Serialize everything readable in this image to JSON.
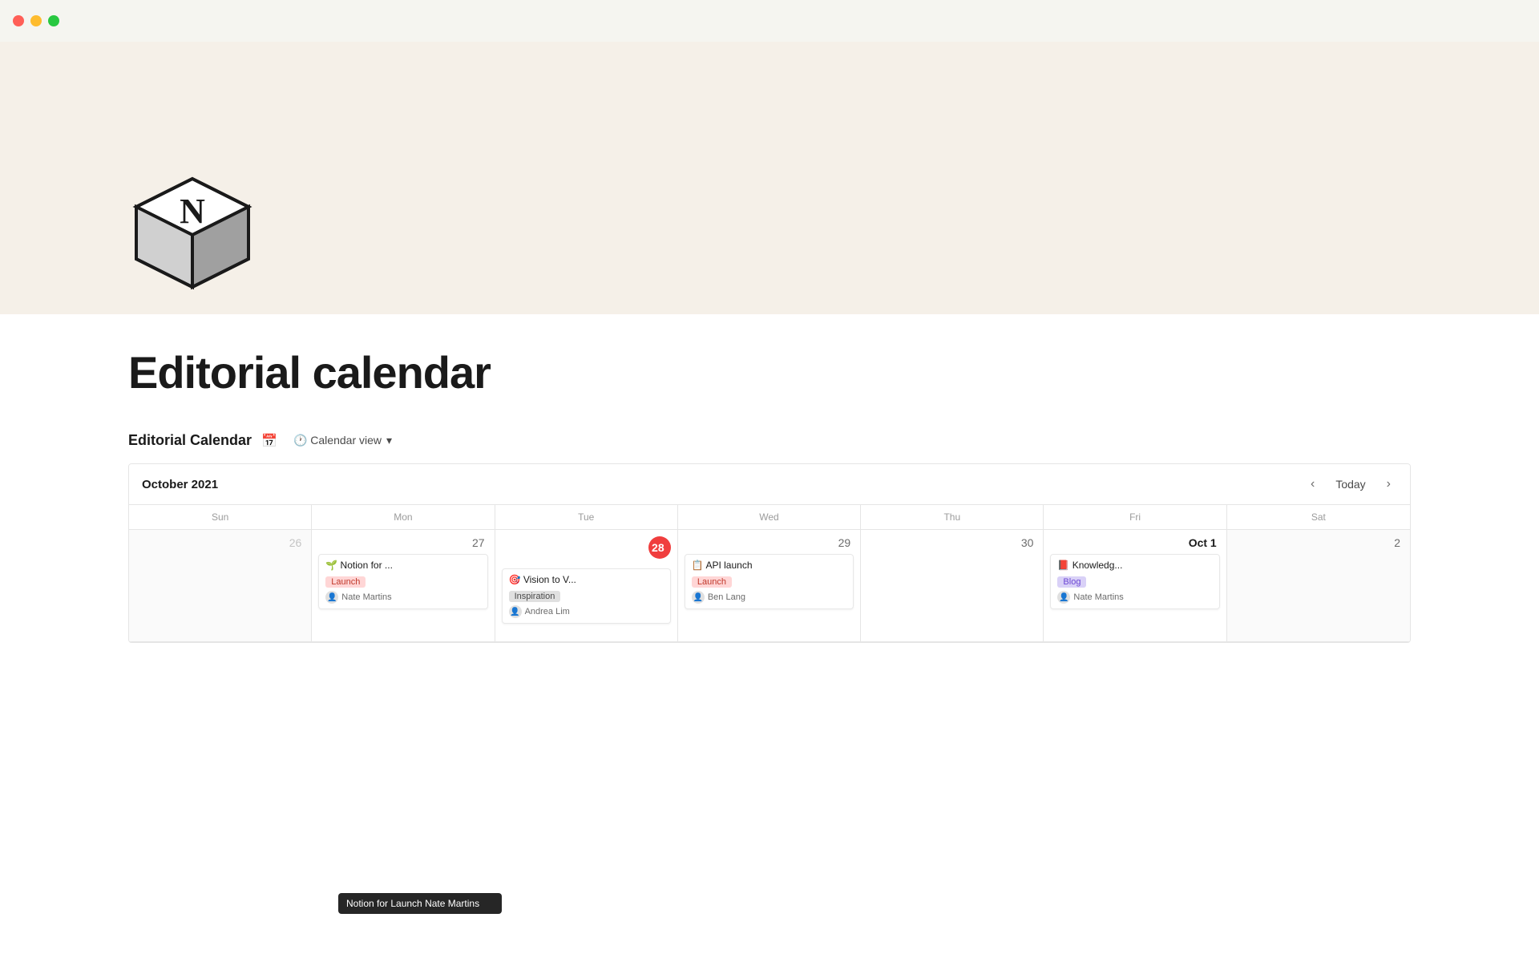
{
  "titlebar": {
    "traffic_lights": [
      "red",
      "yellow",
      "green"
    ]
  },
  "page": {
    "title": "Editorial calendar",
    "cover_bg": "#f5f0e8"
  },
  "database": {
    "name": "Editorial Calendar",
    "view_icon": "📅",
    "view_label": "🕐 Calendar view"
  },
  "calendar": {
    "month_label": "October 2021",
    "today_label": "Today",
    "nav_prev": "‹",
    "nav_next": "›",
    "day_headers": [
      "Sun",
      "Mon",
      "Tue",
      "Wed",
      "Thu",
      "Fri",
      "Sat"
    ],
    "cells": [
      {
        "date": "26",
        "outside": true,
        "events": []
      },
      {
        "date": "27",
        "outside": false,
        "events": [
          {
            "emoji": "🌱",
            "title": "Notion for ...",
            "tag": "Launch",
            "tag_class": "tag-launch",
            "author_icon": "👤",
            "author": "Nate Martins"
          }
        ]
      },
      {
        "date": "28",
        "outside": false,
        "today": true,
        "events": [
          {
            "emoji": "🎯",
            "title": "Vision to V...",
            "tag": "Inspiration",
            "tag_class": "tag-inspiration",
            "author_icon": "👤",
            "author": "Andrea Lim"
          }
        ]
      },
      {
        "date": "29",
        "outside": false,
        "events": [
          {
            "emoji": "📋",
            "title": "API launch",
            "tag": "Launch",
            "tag_class": "tag-launch",
            "author_icon": "👤",
            "author": "Ben Lang"
          }
        ]
      },
      {
        "date": "30",
        "outside": false,
        "events": []
      },
      {
        "date": "Oct 1",
        "outside": false,
        "is_oct1": true,
        "events": [
          {
            "emoji": "📕",
            "title": "Knowledg...",
            "tag": "Blog",
            "tag_class": "tag-blog",
            "author_icon": "👤",
            "author": "Nate Martins"
          }
        ]
      },
      {
        "date": "2",
        "outside": false,
        "weekend": true,
        "events": []
      }
    ]
  },
  "tooltip": {
    "text": "Notion for Launch Nate Martins"
  }
}
